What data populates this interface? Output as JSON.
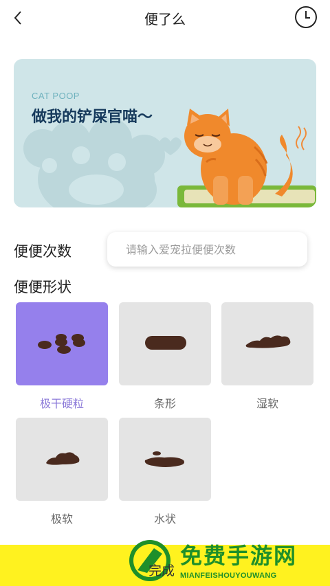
{
  "header": {
    "title": "便了么"
  },
  "banner": {
    "subtitle": "CAT POOP",
    "title": "做我的铲屎官喵～"
  },
  "count": {
    "label": "便便次数",
    "placeholder": "请输入爱宠拉便便次数"
  },
  "shape": {
    "label": "便便形状",
    "options": [
      {
        "label": "极干硬粒",
        "selected": true
      },
      {
        "label": "条形",
        "selected": false
      },
      {
        "label": "湿软",
        "selected": false
      },
      {
        "label": "极软",
        "selected": false
      },
      {
        "label": "水状",
        "selected": false
      }
    ]
  },
  "footer": {
    "finish_label": "完成"
  },
  "watermark": {
    "title": "免费手游网",
    "subtitle": "MIANFEISHOUYOUWANG"
  },
  "colors": {
    "selected_tile": "#9580ec",
    "tile": "#e4e4e4",
    "banner": "#cfe5e8",
    "poop": "#4a2a1e",
    "ad_bar": "#fff21f"
  },
  "icons": [
    "back-icon",
    "clock-icon",
    "cat-illustration"
  ]
}
